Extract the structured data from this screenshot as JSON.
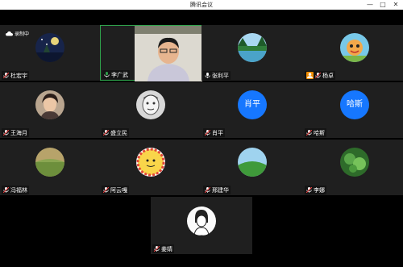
{
  "window": {
    "title": "腾讯会议",
    "controls": [
      "—",
      "□",
      "✕"
    ]
  },
  "recording": {
    "label": "录制中",
    "icon": "cloud-icon"
  },
  "participants": [
    {
      "name": "杜宏宇",
      "mic": "muted",
      "avatar": "night-scene"
    },
    {
      "name": "李广武",
      "mic": "speaking",
      "avatar": "video",
      "active": true
    },
    {
      "name": "张利平",
      "mic": "on",
      "avatar": "lake-scene"
    },
    {
      "name": "杨卓",
      "mic": "muted",
      "avatar": "cartoon",
      "host": true
    },
    {
      "name": "王海月",
      "mic": "muted",
      "avatar": "portrait"
    },
    {
      "name": "盛立民",
      "mic": "muted",
      "avatar": "sketch"
    },
    {
      "name": "肖平",
      "mic": "muted",
      "avatar_text": "肖平"
    },
    {
      "name": "哈斯",
      "mic": "muted",
      "avatar_text": "哈斯"
    },
    {
      "name": "冯福林",
      "mic": "muted",
      "avatar": "field"
    },
    {
      "name": "阿云嘎",
      "mic": "muted",
      "avatar": "sun"
    },
    {
      "name": "邢建华",
      "mic": "muted",
      "avatar": "hill"
    },
    {
      "name": "李娜",
      "mic": "muted",
      "avatar": "leaves"
    },
    {
      "name": "姜婧",
      "mic": "muted",
      "avatar": "cartoon-girl"
    }
  ],
  "colors": {
    "tile_bg": "#1f1f1f",
    "active_border": "#2fa34c",
    "text_avatar": "#1677ff",
    "host_badge": "#f08c00",
    "mic_muted": "#e23b3b",
    "mic_on": "#2fa34c"
  }
}
